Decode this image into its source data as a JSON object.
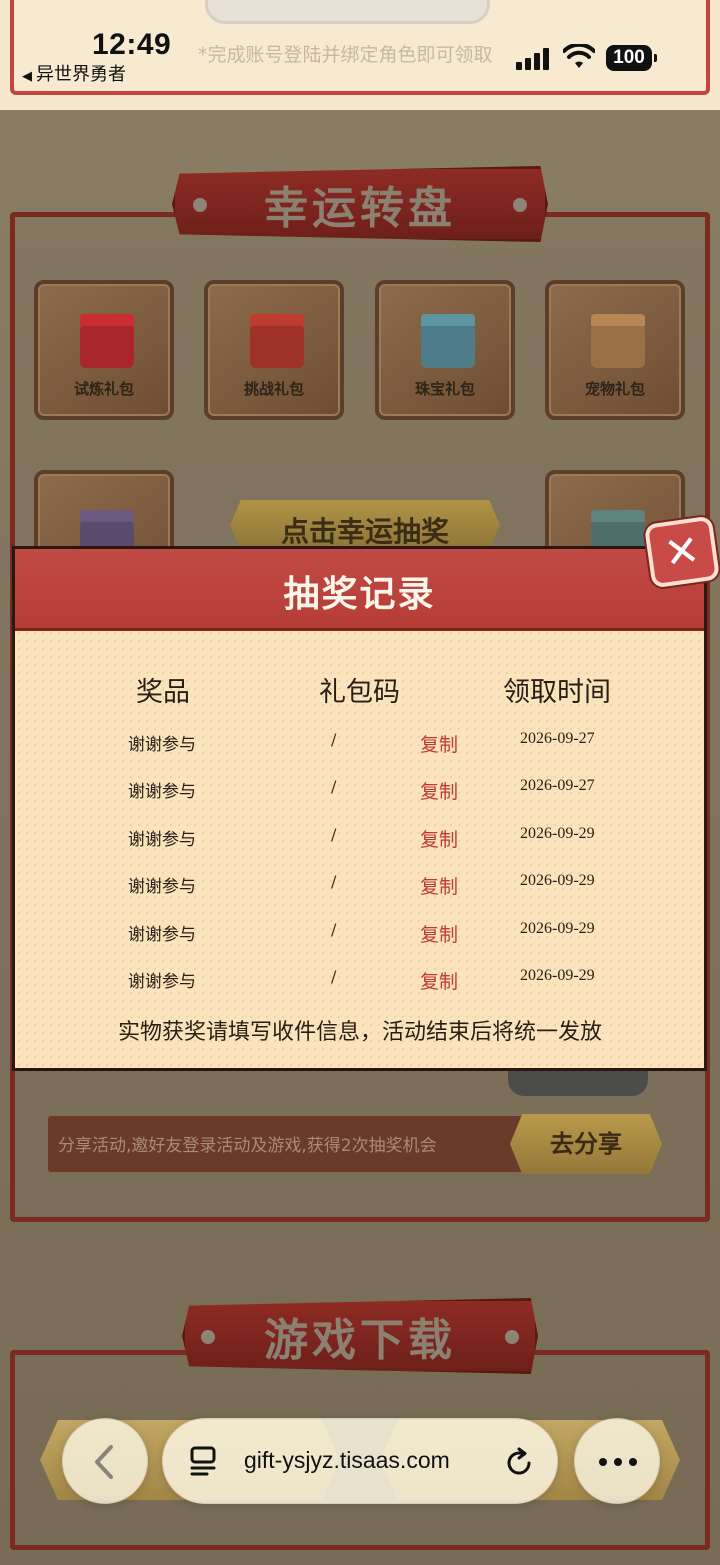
{
  "status_bar": {
    "time": "12:49",
    "back_app": "异世界勇者",
    "battery": "100"
  },
  "top_hint": "*完成账号登陆并绑定角色即可领取",
  "wheel_section": {
    "title": "幸运转盘",
    "gifts": [
      {
        "label": "试炼礼包",
        "icon": "red-giftbox-icon",
        "color": "#b3262b"
      },
      {
        "label": "挑战礼包",
        "icon": "red-giftbox-icon",
        "color": "#a8322a"
      },
      {
        "label": "珠宝礼包",
        "icon": "blue-chest-icon",
        "color": "#4e7c88"
      },
      {
        "label": "宠物礼包",
        "icon": "brown-giftbox-icon",
        "color": "#9a7047"
      }
    ],
    "lottery_button": "点击幸运抽奖"
  },
  "share": {
    "text": "分享活动,邀好友登录活动及游戏,获得2次抽奖机会",
    "button": "去分享"
  },
  "download_section": {
    "title": "游戏下载"
  },
  "modal": {
    "title": "抽奖记录",
    "headers": {
      "prize": "奖品",
      "code": "礼包码",
      "time": "领取时间"
    },
    "records": [
      {
        "prize": "谢谢参与",
        "code": "/",
        "copy": "复制",
        "date": "2026-09-27"
      },
      {
        "prize": "谢谢参与",
        "code": "/",
        "copy": "复制",
        "date": "2026-09-27"
      },
      {
        "prize": "谢谢参与",
        "code": "/",
        "copy": "复制",
        "date": "2026-09-29"
      },
      {
        "prize": "谢谢参与",
        "code": "/",
        "copy": "复制",
        "date": "2026-09-29"
      },
      {
        "prize": "谢谢参与",
        "code": "/",
        "copy": "复制",
        "date": "2026-09-29"
      },
      {
        "prize": "谢谢参与",
        "code": "/",
        "copy": "复制",
        "date": "2026-09-29"
      }
    ],
    "note": "实物获奖请填写收件信息，活动结束后将统一发放"
  },
  "browser": {
    "url": "gift-ysjyz.tisaas.com"
  },
  "colors": {
    "accent_red": "#c24a45",
    "copy_red": "#c23a2f",
    "modal_bg": "#fbe3bd"
  }
}
